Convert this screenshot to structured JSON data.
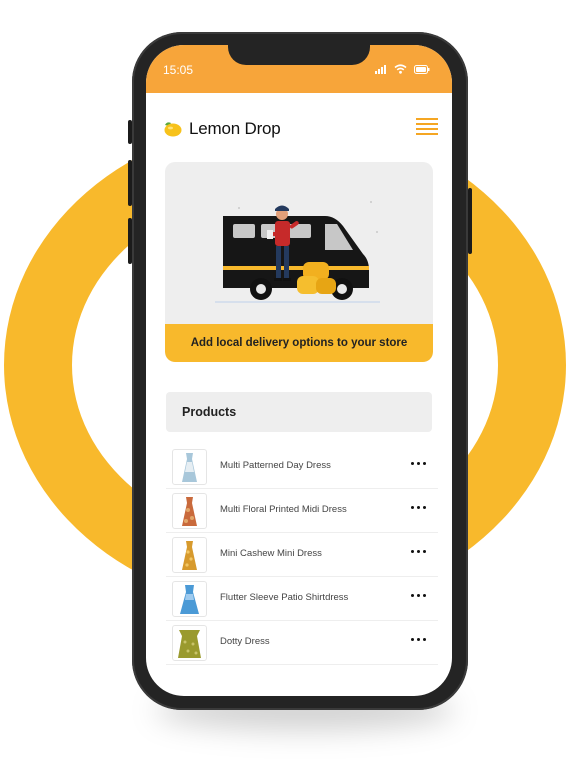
{
  "status_bar": {
    "time": "15:05",
    "icons": [
      "signal-icon",
      "wifi-icon",
      "battery-icon"
    ]
  },
  "app": {
    "brand_name": "Lemon Drop",
    "brand_icon": "lemon-icon",
    "menu_icon": "hamburger-menu-icon"
  },
  "promo": {
    "cta_label": "Add local delivery options to your store",
    "illustration": "delivery-van-illustration"
  },
  "products": {
    "heading": "Products",
    "items": [
      {
        "name": "Multi Patterned Day Dress",
        "thumb_icon": "dress-thumbnail-icon",
        "colors": [
          "#A8C7DA",
          "#E6EEF3"
        ]
      },
      {
        "name": "Multi Floral Printed Midi Dress",
        "thumb_icon": "dress-thumbnail-icon",
        "colors": [
          "#C96A3C",
          "#E3A86B"
        ]
      },
      {
        "name": "Mini Cashew Mini Dress",
        "thumb_icon": "dress-thumbnail-icon",
        "colors": [
          "#D79A2D",
          "#F2C766"
        ]
      },
      {
        "name": "Flutter Sleeve Patio Shirtdress",
        "thumb_icon": "dress-thumbnail-icon",
        "colors": [
          "#4B9AD6",
          "#9FCBEF"
        ]
      },
      {
        "name": "Dotty Dress",
        "thumb_icon": "dress-thumbnail-icon",
        "colors": [
          "#9A9A2E",
          "#C9C46A"
        ]
      }
    ],
    "row_action_icon": "more-options-icon"
  },
  "colors": {
    "accent": "#F7A53A",
    "ring": "#F8B92C",
    "menu": "#F5A623"
  }
}
